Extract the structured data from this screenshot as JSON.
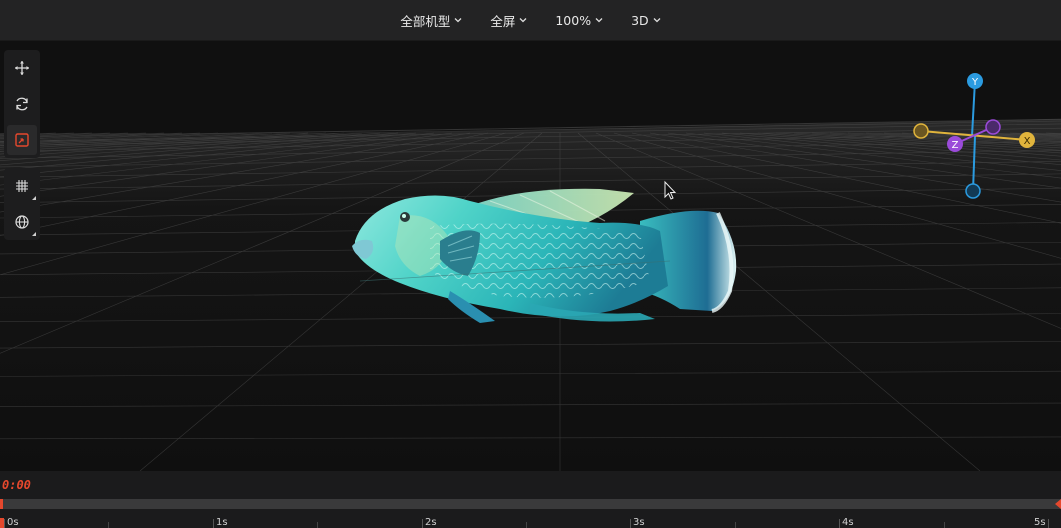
{
  "toolbar": {
    "models_label": "全部机型",
    "fullscreen_label": "全屏",
    "zoom_label": "100%",
    "mode_label": "3D"
  },
  "tools": {
    "move": "move-icon",
    "rotate": "rotate-icon",
    "scale": "scale-icon",
    "grid": "grid-icon",
    "world": "globe-icon"
  },
  "gizmo": {
    "x_label": "X",
    "y_label": "Y",
    "z_label": "Z",
    "colors": {
      "x": "#e0b43c",
      "y": "#2b9be0",
      "z": "#9b4bd9"
    }
  },
  "timeline": {
    "current_time": "0:00",
    "progress": 0,
    "ticks": [
      "0s",
      "1s",
      "2s",
      "3s",
      "4s",
      "5s"
    ],
    "accent": "#e5482d"
  }
}
